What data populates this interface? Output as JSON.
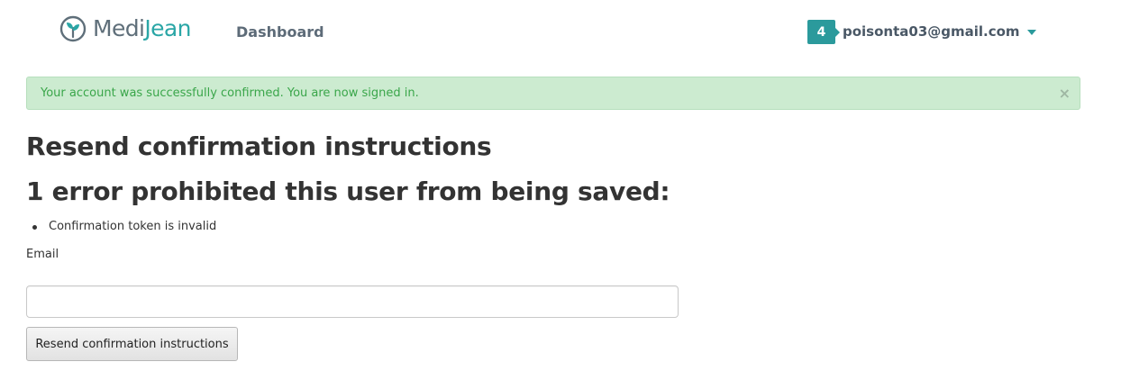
{
  "brand": {
    "name_part1": "Medi",
    "name_part2": "Jean",
    "logo_icon": "leaf-circle-icon",
    "colors": {
      "medi": "#5f6f7a",
      "jean": "#2aa6a6"
    }
  },
  "nav": {
    "dashboard_label": "Dashboard"
  },
  "user_menu": {
    "badge_count": "4",
    "email": "poisonta03@gmail.com",
    "dropdown_icon": "caret-down-icon",
    "accent_color": "#2b9a9c"
  },
  "flash": {
    "message": "Your account was successfully confirmed. You are now signed in.",
    "close_label": "×",
    "colors": {
      "background": "#ccebd0",
      "text": "#3aa64a"
    }
  },
  "page": {
    "title": "Resend confirmation instructions",
    "error_heading": "1 error prohibited this user from being saved:",
    "errors": [
      "Confirmation token is invalid"
    ]
  },
  "form": {
    "email_label": "Email",
    "email_value": "",
    "email_placeholder": "",
    "submit_label": "Resend confirmation instructions"
  }
}
